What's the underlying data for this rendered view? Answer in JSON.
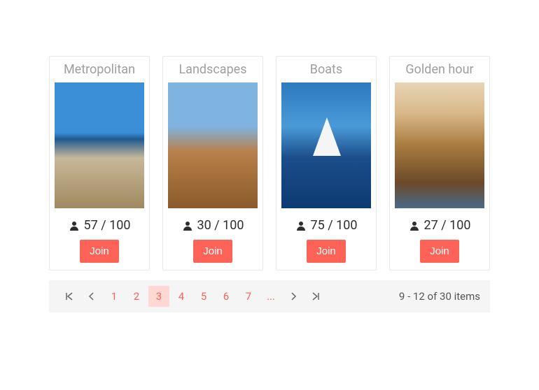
{
  "cards": [
    {
      "title": "Metropolitan",
      "count": "57 / 100",
      "join": "Join",
      "imgClass": "img-metro"
    },
    {
      "title": "Landscapes",
      "count": "30 / 100",
      "join": "Join",
      "imgClass": "img-land"
    },
    {
      "title": "Boats",
      "count": "75 / 100",
      "join": "Join",
      "imgClass": "img-boats"
    },
    {
      "title": "Golden hour",
      "count": "27 / 100",
      "join": "Join",
      "imgClass": "img-golden"
    }
  ],
  "pager": {
    "pages": [
      "1",
      "2",
      "3",
      "4",
      "5",
      "6",
      "7"
    ],
    "active": "3",
    "ellipsis": "...",
    "info": "9 - 12 of 30 items"
  }
}
